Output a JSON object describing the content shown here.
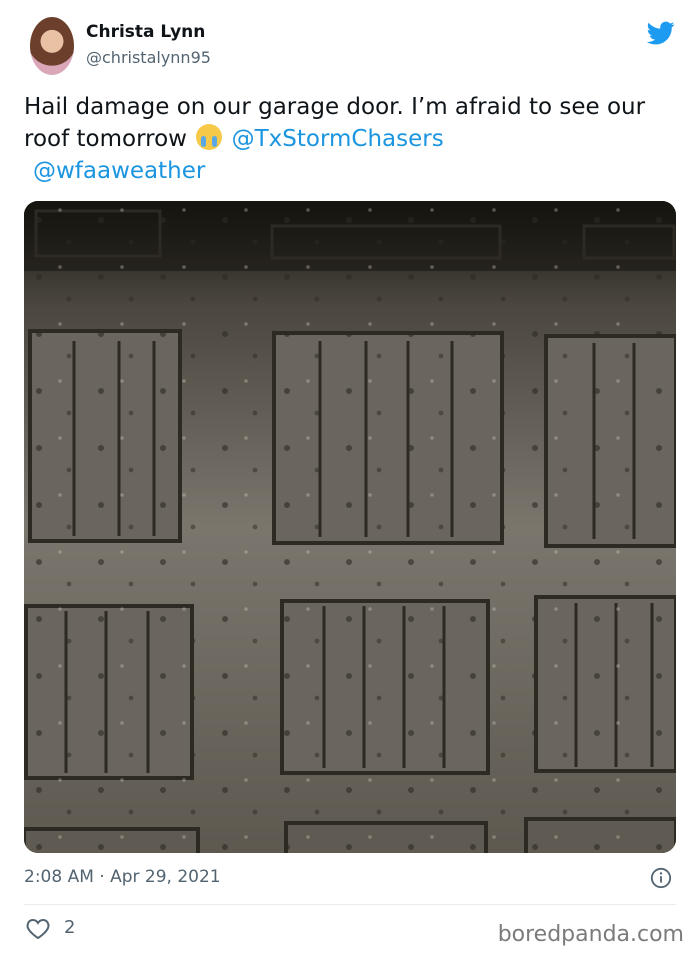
{
  "user": {
    "name": "Christa Lynn",
    "handle": "@christalynn95"
  },
  "tweet": {
    "text_part1": "Hail damage on our garage door. I’m afraid to see our roof tomorrow",
    "emoji_icon": "loudly-crying-face-emoji",
    "mention1": "@TxStormChasers",
    "mention2": "@wfaaweather"
  },
  "meta": {
    "time": "2:08 AM",
    "separator": "·",
    "date": "Apr 29, 2021"
  },
  "likes_count": "2",
  "watermark": "boredpanda.com",
  "colors": {
    "link": "#1b95e0",
    "twitter_blue": "#1d9bf0",
    "muted": "#536471"
  }
}
